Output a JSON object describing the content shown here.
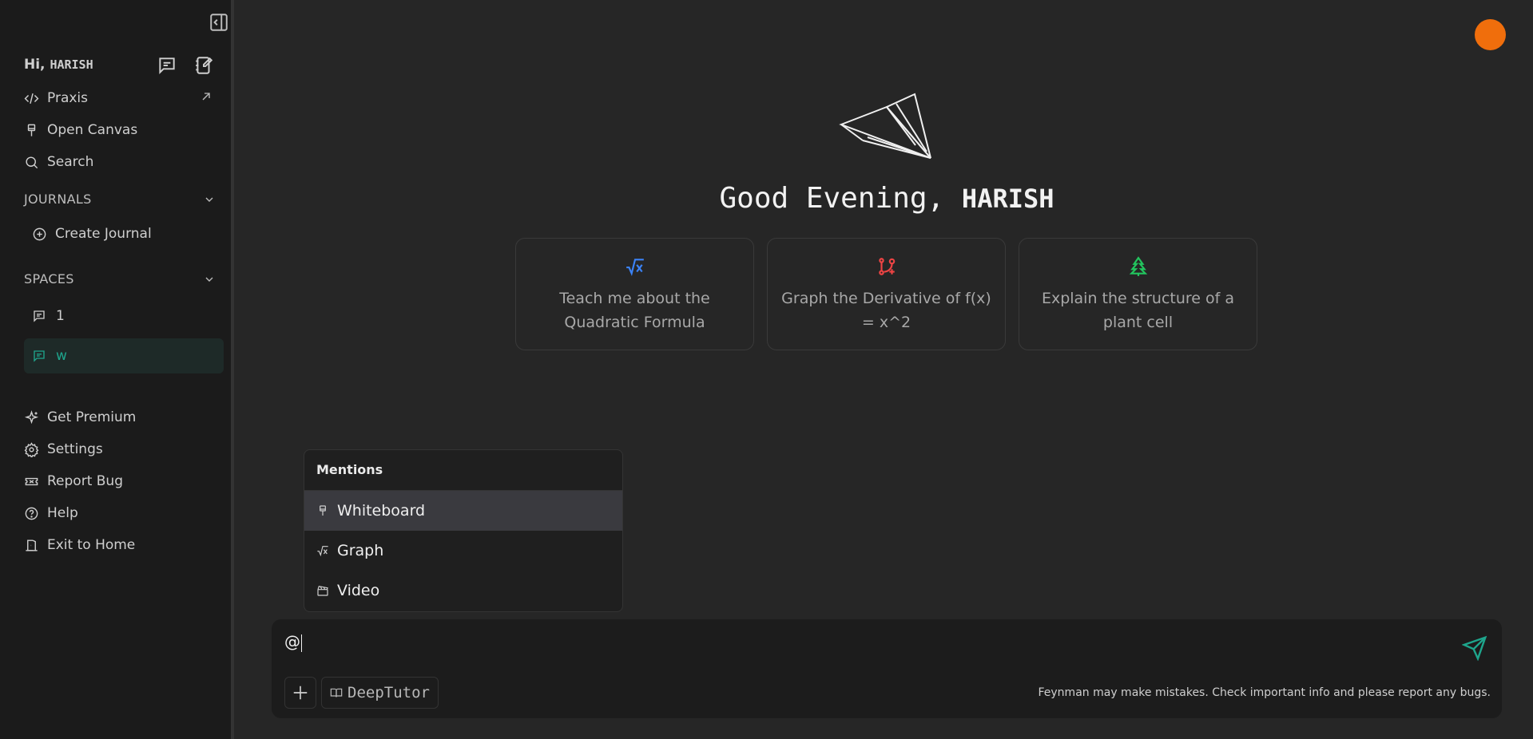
{
  "sidebar": {
    "greeting_prefix": "Hi,",
    "user_name": "HARISH",
    "nav": [
      {
        "label": "Praxis",
        "icon": "code-icon"
      },
      {
        "label": "Open Canvas",
        "icon": "brush-icon"
      },
      {
        "label": "Search",
        "icon": "search-icon"
      }
    ],
    "journals": {
      "heading": "JOURNALS",
      "create_label": "Create Journal"
    },
    "spaces": {
      "heading": "SPACES",
      "items": [
        {
          "label": "1",
          "active": false
        },
        {
          "label": "w",
          "active": true
        }
      ]
    },
    "bottom": [
      {
        "label": "Get Premium",
        "icon": "sparkles-icon"
      },
      {
        "label": "Settings",
        "icon": "gear-icon"
      },
      {
        "label": "Report Bug",
        "icon": "ticket-icon"
      },
      {
        "label": "Help",
        "icon": "help-circle-icon"
      },
      {
        "label": "Exit to Home",
        "icon": "exit-door-icon"
      }
    ]
  },
  "main": {
    "greeting_prefix": "Good Evening,",
    "user_name": "HARISH",
    "cards": [
      {
        "text": "Teach me about the Quadratic Formula",
        "icon": "square-root-icon",
        "color": "#3b82f6"
      },
      {
        "text": "Graph the Derivative of f(x) = x^2",
        "icon": "git-branch-plus-icon",
        "color": "#ef4444"
      },
      {
        "text": "Explain the structure of a plant cell",
        "icon": "tree-icon",
        "color": "#22c55e"
      }
    ],
    "avatar_color": "#f06e0c"
  },
  "mentions": {
    "title": "Mentions",
    "items": [
      {
        "label": "Whiteboard",
        "icon": "brush-icon"
      },
      {
        "label": "Graph",
        "icon": "square-root-icon"
      },
      {
        "label": "Video",
        "icon": "clapperboard-icon"
      }
    ]
  },
  "composer": {
    "input_value": "@",
    "mode_label": "DeepTutor",
    "disclaimer": "Feynman may make mistakes. Check important info and please report any bugs.",
    "send_color": "#1ea58c"
  }
}
